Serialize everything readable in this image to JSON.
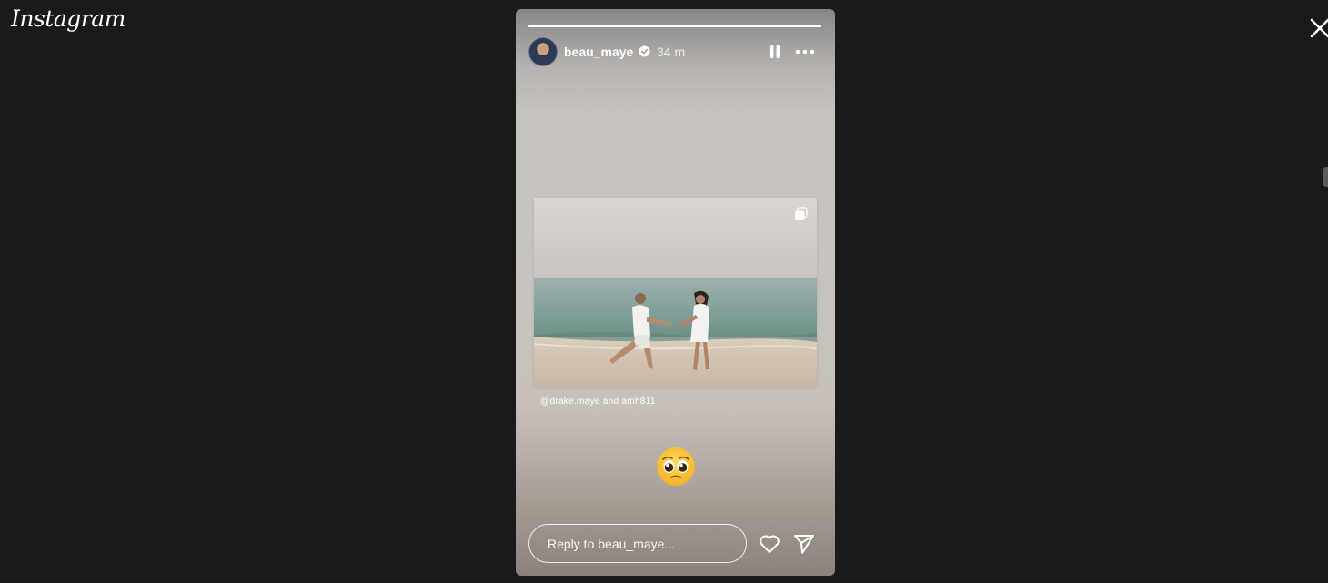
{
  "brand": {
    "logo_text": "Instagram"
  },
  "story": {
    "username": "beau_maye",
    "verified": true,
    "timestamp": "34 m",
    "progress_fraction": 1.0,
    "caption": {
      "mention": "@drake.maye",
      "connector": "and",
      "second_user": "amh811"
    },
    "sticker_icon": "pleading-face-emoji"
  },
  "reply": {
    "placeholder": "Reply to beau_maye..."
  },
  "icons": {
    "close": "close-icon",
    "pause": "pause-icon",
    "more": "more-options-icon",
    "like": "heart-icon",
    "share": "send-icon",
    "verified": "verified-badge-icon",
    "multi_photo": "multi-photo-icon"
  },
  "colors": {
    "background": "#1a1a1a",
    "text_primary": "#ffffff",
    "verified_badge": "#ffffff"
  }
}
